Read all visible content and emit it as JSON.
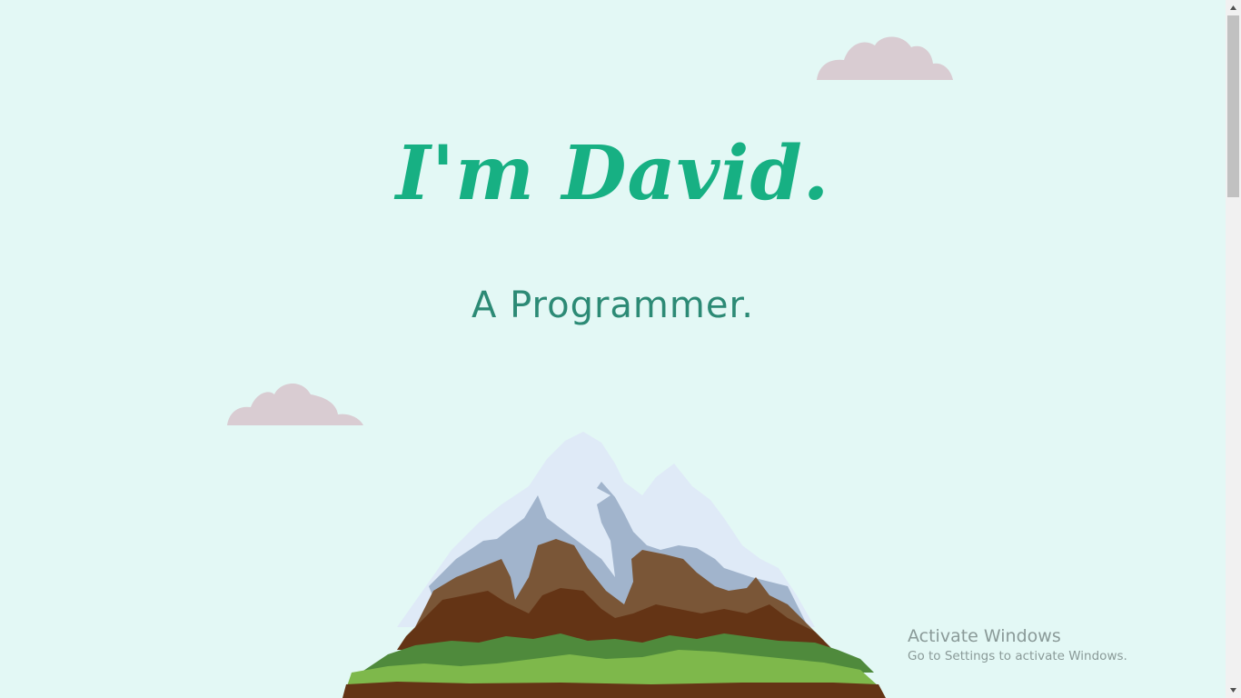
{
  "hero": {
    "headline": "I'm David.",
    "subheadline": "A Programmer."
  },
  "watermark": {
    "title": "Activate Windows",
    "subtitle": "Go to Settings to activate Windows."
  },
  "icons": {
    "clouds": "cloud-icon",
    "mountain": "mountain-illustration",
    "scroll_up": "chevron-up-icon",
    "scroll_down": "chevron-down-icon"
  },
  "colors": {
    "background": "#e3f8f5",
    "headline": "#17b083",
    "subheadline": "#2c8a75",
    "cloud": "#d9ccd2",
    "watermark": "#8a9a98"
  }
}
